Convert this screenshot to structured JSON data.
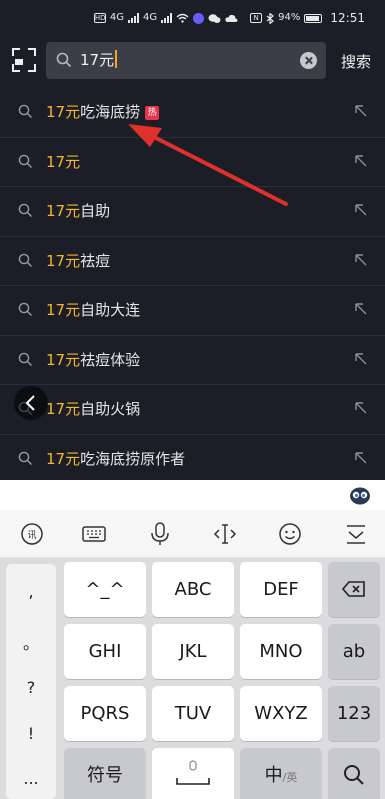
{
  "status_bar": {
    "network_badge": "HD",
    "signal1_label": "4G",
    "signal2_label": "4G",
    "nfc_label": "N",
    "battery": "94%",
    "time": "12:51"
  },
  "search": {
    "query": "17元",
    "submit_label": "搜索"
  },
  "suggestions": [
    {
      "highlight": "17元",
      "rest": "吃海底捞",
      "badge": "热"
    },
    {
      "highlight": "17元",
      "rest": "",
      "badge": ""
    },
    {
      "highlight": "17元",
      "rest": "自助",
      "badge": ""
    },
    {
      "highlight": "17元",
      "rest": "祛痘",
      "badge": ""
    },
    {
      "highlight": "17元",
      "rest": "自助大连",
      "badge": ""
    },
    {
      "highlight": "17元",
      "rest": "祛痘体验",
      "badge": ""
    },
    {
      "highlight": "17元",
      "rest": "自助火锅",
      "badge": ""
    },
    {
      "highlight": "17元",
      "rest": "吃海底捞原作者",
      "badge": ""
    }
  ],
  "keyboard": {
    "side_keys": [
      ",",
      "。",
      "?",
      "!",
      "..."
    ],
    "keys": {
      "k1": "^_^",
      "k2": "ABC",
      "k3": "DEF",
      "k4": "GHI",
      "k5": "JKL",
      "k6": "MNO",
      "k_ab": "ab",
      "k7": "PQRS",
      "k8": "TUV",
      "k9": "WXYZ",
      "k_num": "123",
      "symbols": "符号",
      "lang_main": "中",
      "lang_sub": "/英"
    }
  },
  "colors": {
    "highlight": "#f5b82e",
    "hot_badge": "#e8344e",
    "annotation_arrow": "#e0302c"
  }
}
